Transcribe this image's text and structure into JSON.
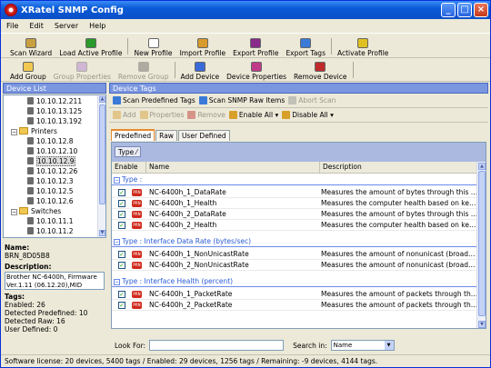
{
  "window": {
    "title": "XRatel SNMP Config",
    "min": "_",
    "max": "□",
    "close": "×"
  },
  "menu": [
    "File",
    "Edit",
    "Server",
    "Help"
  ],
  "toolbar1": [
    {
      "label": "Scan Wizard",
      "color": "#c8a040",
      "enabled": true
    },
    {
      "label": "Load Active Profile",
      "color": "#2a9a2a",
      "enabled": true
    },
    {
      "label": "New Profile",
      "color": "#ffffff",
      "enabled": true
    },
    {
      "label": "Import Profile",
      "color": "#d89a2a",
      "enabled": true
    },
    {
      "label": "Export Profile",
      "color": "#8a2a8a",
      "enabled": true
    },
    {
      "label": "Export Tags",
      "color": "#3a7ad8",
      "enabled": true
    },
    {
      "label": "Activate Profile",
      "color": "#e0c020",
      "enabled": true
    }
  ],
  "toolbar2": [
    {
      "label": "Add Group",
      "color": "#f0c850",
      "enabled": true
    },
    {
      "label": "Group Properties",
      "color": "#b07ad0",
      "enabled": false
    },
    {
      "label": "Remove Group",
      "color": "#606060",
      "enabled": false
    },
    {
      "label": "Add Device",
      "color": "#3a6ad8",
      "enabled": true
    },
    {
      "label": "Device Properties",
      "color": "#c03a8a",
      "enabled": true
    },
    {
      "label": "Remove Device",
      "color": "#c02a2a",
      "enabled": true
    }
  ],
  "left": {
    "header": "Device List",
    "tree": [
      {
        "indent": 2,
        "type": "device",
        "label": "10.10.12.211"
      },
      {
        "indent": 2,
        "type": "device",
        "label": "10.10.13.125"
      },
      {
        "indent": 2,
        "type": "device",
        "label": "10.10.13.192"
      },
      {
        "indent": 1,
        "type": "folder",
        "label": "Printers"
      },
      {
        "indent": 2,
        "type": "device",
        "label": "10.10.12.8"
      },
      {
        "indent": 2,
        "type": "device",
        "label": "10.10.12.10"
      },
      {
        "indent": 2,
        "type": "device",
        "label": "10.10.12.9",
        "selected": true
      },
      {
        "indent": 2,
        "type": "device",
        "label": "10.10.12.26"
      },
      {
        "indent": 2,
        "type": "device",
        "label": "10.10.12.3"
      },
      {
        "indent": 2,
        "type": "device",
        "label": "10.10.12.5"
      },
      {
        "indent": 2,
        "type": "device",
        "label": "10.10.12.6"
      },
      {
        "indent": 1,
        "type": "folder",
        "label": "Switches"
      },
      {
        "indent": 2,
        "type": "device",
        "label": "10.10.11.1"
      },
      {
        "indent": 2,
        "type": "device",
        "label": "10.10.11.2"
      }
    ],
    "scroll": {
      "up": "▲",
      "down": "▼"
    },
    "name_label": "Name:",
    "name_value": "BRN_8D05B8",
    "desc_label": "Description:",
    "desc_value": "Brother NC-6400h, Firmware Ver.1.11  (06.12.20),MID",
    "tags_label": "Tags:",
    "tags_lines": [
      "Enabled: 26",
      "Detected Predefined: 10",
      "Detected Raw: 16",
      "User Defined: 0"
    ]
  },
  "right": {
    "header": "Device Tags",
    "scan_toolbar": [
      {
        "label": "Scan Predefined Tags",
        "color": "#3a7ad8",
        "enabled": true
      },
      {
        "label": "Scan SNMP Raw Items",
        "color": "#3a7ad8",
        "enabled": true
      },
      {
        "label": "Abort Scan",
        "color": "#909090",
        "enabled": false
      }
    ],
    "tag_toolbar": [
      {
        "label": "Add",
        "color": "#d89a2a",
        "enabled": false
      },
      {
        "label": "Properties",
        "color": "#d89a2a",
        "enabled": false
      },
      {
        "label": "Remove",
        "color": "#c02a2a",
        "enabled": false
      },
      {
        "label": "Enable All ▾",
        "color": "#d8a02a",
        "enabled": true
      },
      {
        "label": "Disable All ▾",
        "color": "#d8a02a",
        "enabled": true
      }
    ],
    "tabs": [
      {
        "label": "Predefined",
        "active": true
      },
      {
        "label": "Raw",
        "active": false
      },
      {
        "label": "User Defined",
        "active": false
      }
    ],
    "group_chip": "Type",
    "columns": [
      "Enable",
      "Name",
      "Description"
    ],
    "groups": [
      {
        "title": "Type :",
        "rows": [
          {
            "name": "NC-6400h_1_DataRate",
            "desc": "Measures the amount of bytes through this interface."
          },
          {
            "name": "NC-6400h_1_Health",
            "desc": "Measures the computer health based on key perfor..."
          },
          {
            "name": "NC-6400h_2_DataRate",
            "desc": "Measures the amount of bytes through this interface."
          },
          {
            "name": "NC-6400h_2_Health",
            "desc": "Measures the computer health based on key perfor..."
          }
        ]
      },
      {
        "title": "Type : Interface Data Rate (bytes/sec)",
        "rows": [
          {
            "name": "NC-6400h_1_NonUnicastRate",
            "desc": "Measures the amount of nonunicast (broadcast, mult..."
          },
          {
            "name": "NC-6400h_2_NonUnicastRate",
            "desc": "Measures the amount of nonunicast (broadcast, mult..."
          }
        ]
      },
      {
        "title": "Type : Interface Health (percent)",
        "rows": [
          {
            "name": "NC-6400h_1_PacketRate",
            "desc": "Measures the amount of packets through this interfa..."
          },
          {
            "name": "NC-6400h_2_PacketRate",
            "desc": "Measures the amount of packets through this interfa..."
          }
        ]
      }
    ],
    "tag_badge": "PRN",
    "check": "✓",
    "look_for_label": "Look For:",
    "look_for_value": "",
    "search_in_label": "Search in:",
    "search_in_value": "Name"
  },
  "status": "Software license: 20 devices, 5400 tags / Enabled: 29 devices, 1256 tags / Remaining: -9 devices, 4144 tags."
}
